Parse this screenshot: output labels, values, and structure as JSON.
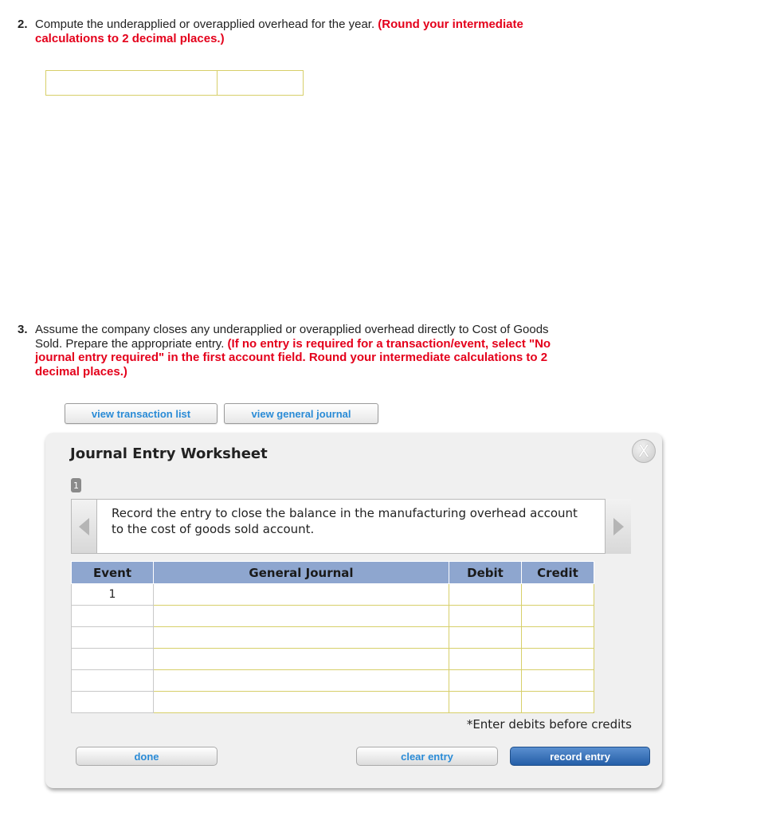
{
  "q2": {
    "num": "2.",
    "text": "Compute the underapplied or overapplied overhead for the year.",
    "note_a": "(Round your intermediate",
    "note_b": "calculations to 2 decimal places.)"
  },
  "q3": {
    "num": "3.",
    "line1": "Assume the company closes any underapplied or overapplied overhead directly to Cost of Goods",
    "line2_plain": "Sold. Prepare the appropriate entry.",
    "line2_red": "(If no entry is required for a transaction/event, select \"No",
    "line3": "journal entry required\" in the first account field. Round your intermediate calculations to 2",
    "line4": "decimal places.)"
  },
  "buttons": {
    "view_transaction_list": "view transaction list",
    "view_general_journal": "view general journal"
  },
  "worksheet": {
    "title": "Journal Entry Worksheet",
    "close_glyph": "X",
    "entry_number": "1",
    "instruction": "Record the entry to close the balance in the manufacturing overhead account to the cost of goods sold account.",
    "columns": [
      "Event",
      "General Journal",
      "Debit",
      "Credit"
    ],
    "rows": [
      {
        "event": "1",
        "account": "",
        "debit": "",
        "credit": ""
      },
      {
        "event": "",
        "account": "",
        "debit": "",
        "credit": ""
      },
      {
        "event": "",
        "account": "",
        "debit": "",
        "credit": ""
      },
      {
        "event": "",
        "account": "",
        "debit": "",
        "credit": ""
      },
      {
        "event": "",
        "account": "",
        "debit": "",
        "credit": ""
      },
      {
        "event": "",
        "account": "",
        "debit": "",
        "credit": ""
      }
    ],
    "note": "*Enter debits before credits",
    "done_label": "done",
    "clear_label": "clear entry",
    "record_label": "record entry"
  },
  "colors": {
    "accent_red": "#e4001b",
    "header_blue": "#8ea6cf",
    "link_blue": "#2a8bd6",
    "input_border": "#d7cf6a",
    "record_button": "#245ea7"
  }
}
